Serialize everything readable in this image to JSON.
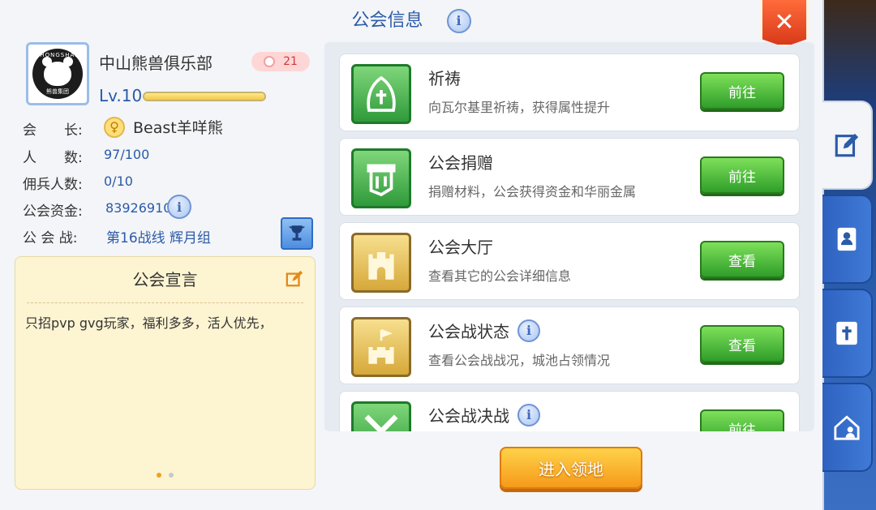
{
  "window": {
    "title": "公会信息",
    "close_label": "✕"
  },
  "guild": {
    "name": "中山熊兽俱乐部",
    "emblem_text_top": "ZHONGSHAN",
    "emblem_text_bottom": "熊兽集团",
    "badge_count": "21",
    "level": "Lv.10",
    "level_progress": 1.0
  },
  "info": {
    "leader_label": "会　　长:",
    "leader_value": "Beast羊咩熊",
    "members_label": "人　　数:",
    "members_value": "97/100",
    "mercs_label": "佣兵人数:",
    "mercs_value": "0/10",
    "funds_label": "公会资金:",
    "funds_value": "83926910",
    "war_label": "公 会 战:",
    "war_value": "第16战线  辉月组"
  },
  "declaration": {
    "title": "公会宣言",
    "text": "只招pvp gvg玩家，福利多多，活人优先，"
  },
  "features": [
    {
      "name": "祈祷",
      "desc": "向瓦尔基里祈祷，获得属性提升",
      "button": "前往",
      "icon": "prayer-icon"
    },
    {
      "name": "公会捐赠",
      "desc": "捐赠材料，公会获得资金和华丽金属",
      "button": "前往",
      "icon": "donation-icon"
    },
    {
      "name": "公会大厅",
      "desc": "查看其它的公会详细信息",
      "button": "查看",
      "icon": "castle-icon"
    },
    {
      "name": "公会战状态",
      "desc": "查看公会战战况，城池占领情况",
      "button": "查看",
      "icon": "fortress-icon"
    },
    {
      "name": "公会战决战",
      "desc": "",
      "button": "前往",
      "icon": "crossed-swords-icon"
    }
  ],
  "enter_button": "进入领地",
  "colors": {
    "accent": "#2b5aa8",
    "green_button": "#3aa830",
    "orange_button": "#f5a020",
    "close": "#e24a20"
  }
}
